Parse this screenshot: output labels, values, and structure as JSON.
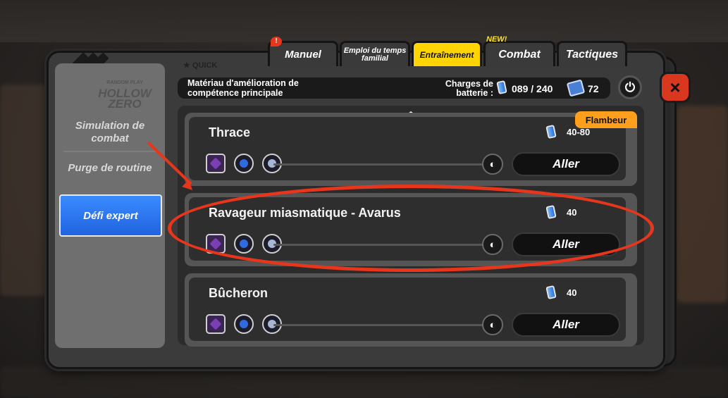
{
  "tabs": [
    {
      "label": "Manuel",
      "badge": "!"
    },
    {
      "label": "Emploi du temps familial"
    },
    {
      "label": "Entraînement",
      "active": true
    },
    {
      "label": "Combat",
      "badge": "NEW!"
    },
    {
      "label": "Tactiques"
    }
  ],
  "quick_label": "★ QUICK",
  "header": {
    "title": "Matériau d'amélioration de compétence principale",
    "charges_label": "Charges de batterie :",
    "charges_value": "089 / 240",
    "box_value": "72"
  },
  "sidebar": {
    "logo_top": "RANDOM PLAY",
    "logo_text": "HOLLOW ZERO",
    "items": [
      {
        "label": "Simulation de combat"
      },
      {
        "label": "Purge de routine"
      },
      {
        "label": "Défi expert",
        "active": true
      }
    ]
  },
  "cards": [
    {
      "title": "Thrace",
      "cost": "40-80",
      "tag": "Flambeur",
      "button": "Aller"
    },
    {
      "title": "Ravageur miasmatique - Avarus",
      "cost": "40",
      "button": "Aller"
    },
    {
      "title": "Bûcheron",
      "cost": "40",
      "button": "Aller"
    }
  ],
  "icons": {
    "close": "×",
    "power": "⏻",
    "radar": "◐",
    "scroll_up": "▲",
    "scroll_down": "▼"
  },
  "colors": {
    "accent_yellow": "#ffd400",
    "active_blue": "#2a74f0",
    "tag_orange": "#ff9f1c",
    "annotation_red": "#e8361d",
    "close_red": "#d9371e"
  }
}
